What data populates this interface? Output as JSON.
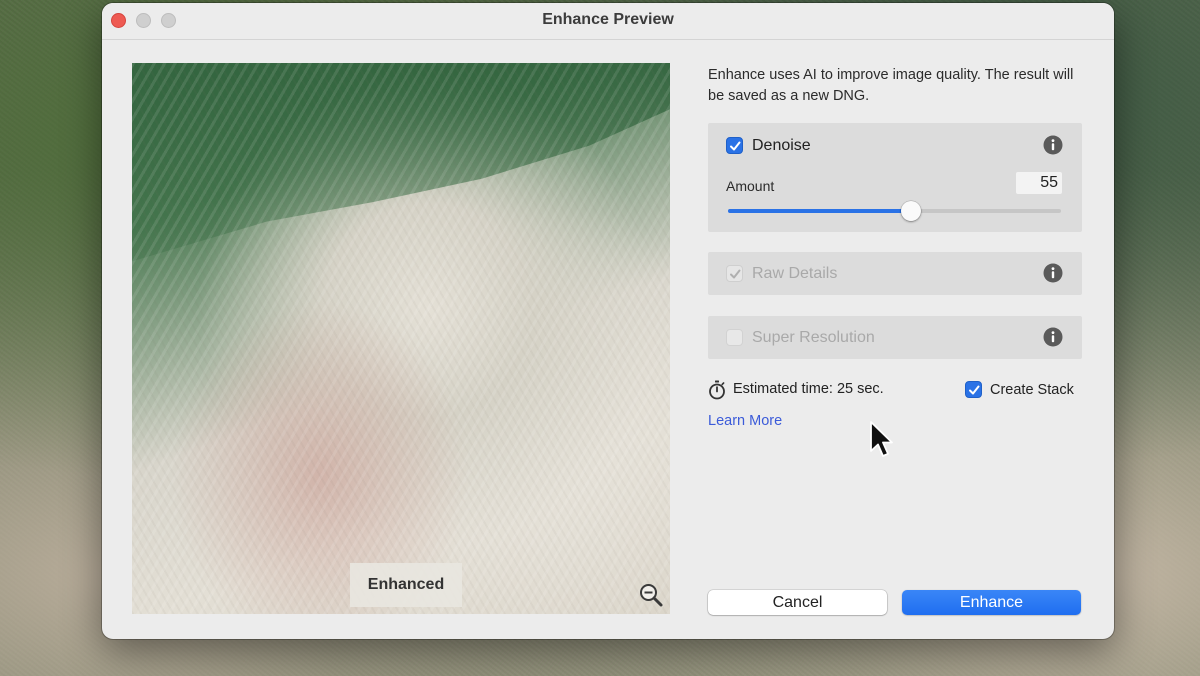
{
  "window": {
    "title": "Enhance Preview"
  },
  "preview": {
    "tag_label": "Enhanced",
    "zoom_icon": "zoom-out-icon"
  },
  "description": "Enhance uses AI to improve image quality. The result will be saved as a new DNG.",
  "denoise": {
    "label": "Denoise",
    "checked": true,
    "amount_label": "Amount",
    "amount_value": "55",
    "slider_fraction": 0.55
  },
  "raw_details": {
    "label": "Raw Details",
    "checked": true,
    "enabled": false
  },
  "super_resolution": {
    "label": "Super Resolution",
    "checked": false,
    "enabled": false
  },
  "estimate": {
    "text": "Estimated time: 25 sec."
  },
  "create_stack": {
    "label": "Create Stack",
    "checked": true
  },
  "learn_more": "Learn More",
  "buttons": {
    "cancel": "Cancel",
    "enhance": "Enhance"
  },
  "colors": {
    "accent": "#2a72e6",
    "link": "#3b5bd9",
    "close_button": "#ee5a52"
  }
}
